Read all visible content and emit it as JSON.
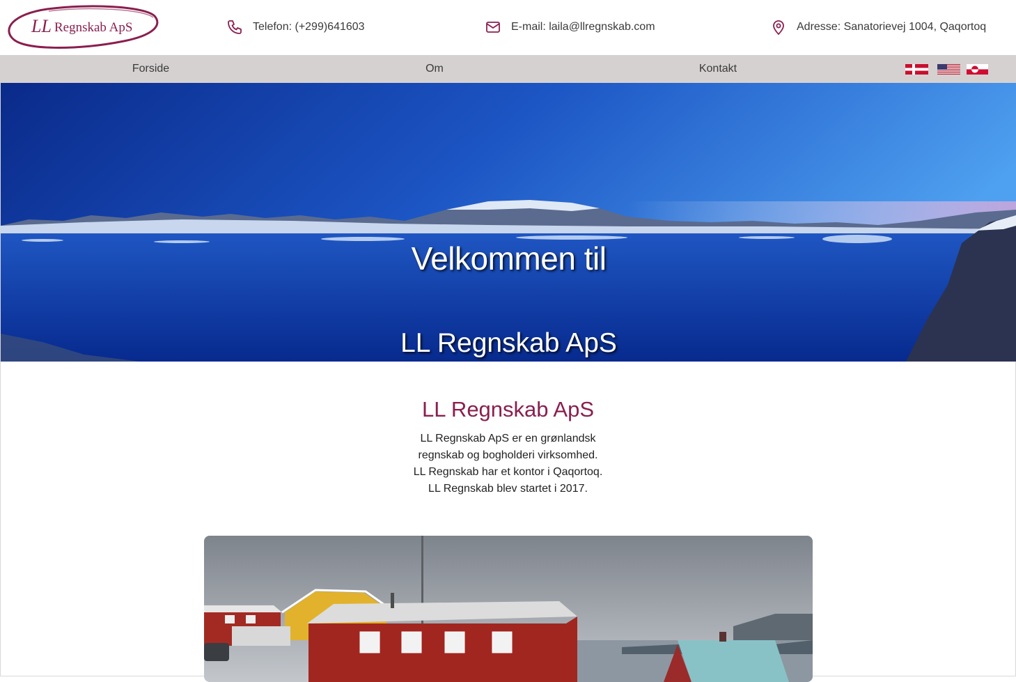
{
  "header": {
    "logo_text": "LL Regnskab ApS",
    "logo_monogram": "LL",
    "phone": "Telefon: (+299)641603",
    "email": "E-mail: laila@llregnskab.com",
    "address": "Adresse: Sanatorievej 1004, Qaqortoq",
    "icons": [
      "phone-icon",
      "mail-icon",
      "map-pin-icon"
    ]
  },
  "nav": {
    "items": [
      {
        "label": "Forside"
      },
      {
        "label": "Om"
      },
      {
        "label": "Kontakt"
      }
    ],
    "languages": [
      "danish-flag",
      "us-flag",
      "greenland-flag"
    ]
  },
  "hero": {
    "title": "Velkommen til",
    "subtitle": "LL Regnskab ApS"
  },
  "about": {
    "heading": "LL Regnskab ApS",
    "lines": [
      "LL Regnskab ApS er en grønlandsk",
      "regnskab og bogholderi virksomhed.",
      "LL Regnskab har et kontor i Qaqortoq.",
      "LL Regnskab blev startet i 2017."
    ]
  },
  "colors": {
    "brand": "#8a1f4f",
    "navbar_bg": "#d6d1d1",
    "text": "#3a3a3a"
  }
}
